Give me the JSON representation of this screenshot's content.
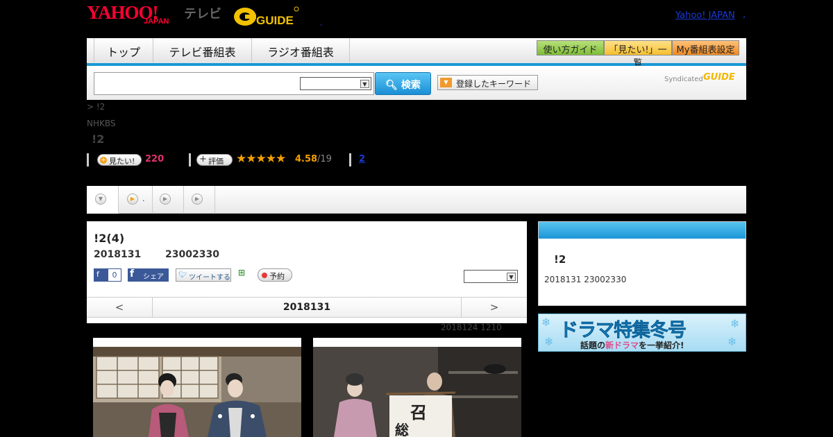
{
  "header": {
    "brand": "YAHOO!",
    "brand_sub": "JAPAN",
    "service": "テレビ",
    "gguide": "GUIDE",
    "top_link": "Yahoo! JAPAN",
    "sep": ",",
    "sep2": ","
  },
  "nav": {
    "tabs": [
      "トップ",
      "テレビ番組表",
      "ラジオ番組表"
    ],
    "guide": "使い方ガイド",
    "want_list": "「見たい!」一覧",
    "my_table": "My番組表設定"
  },
  "search": {
    "placeholder": "",
    "select_value": "",
    "button": "検索",
    "keyword_button": "登録したキーワード",
    "syndicated": "Syndicated",
    "syndicated_logo": "GUIDE"
  },
  "breadcrumb": ">  !2",
  "channel": "NHKBS",
  "program_title": "!2",
  "stats": {
    "want_label": "見たい!",
    "want_count": "220",
    "rate_label": "評価",
    "stars": "★★★★★",
    "rating": "4.58",
    "rating_count": "/19",
    "link": "2"
  },
  "subtabs": [
    "",
    ".",
    "",
    ""
  ],
  "episode": {
    "title": "!2(4)",
    "date": "2018131",
    "time": "23002330",
    "fb_label": "",
    "fb_count": "0",
    "fb_share": "シェア",
    "tweet": "ツイートする",
    "reserve": "予約",
    "select_value": ""
  },
  "date_nav": {
    "prev": "<",
    "date": "2018131",
    "next": ">"
  },
  "updated": "2018124  1210",
  "side": {
    "title": "!2",
    "date": "2018131  23002330"
  },
  "banner": {
    "line1": "ドラマ特集冬号",
    "line2a": "話題の",
    "line2b": "新ドラマ",
    "line2c": "を一挙紹介!"
  },
  "photos": {
    "right_sign_top": "召",
    "right_sign_bottom": "総"
  }
}
